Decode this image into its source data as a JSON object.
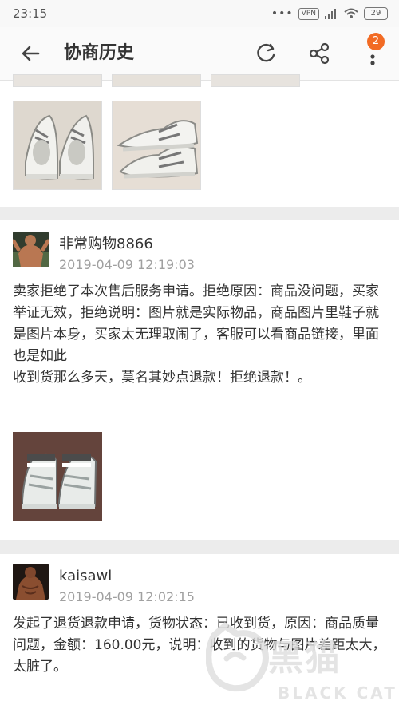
{
  "status_bar": {
    "time": "23:15",
    "indicators": "•••",
    "vpn": "VPN",
    "battery": "29"
  },
  "app_bar": {
    "title": "协商历史",
    "badge_count": "2",
    "icons": [
      "back-arrow",
      "refresh",
      "share",
      "more-vertical"
    ]
  },
  "entries": [
    {
      "username": "非常购物8866",
      "timestamp": "2019-04-09 12:19:03",
      "message": "卖家拒绝了本次售后服务申请。拒绝原因：商品没问题，买家举证无效，拒绝说明：图片就是实际物品，商品图片里鞋子就是图片本身，买家太无理取闹了，客服可以看商品链接，里面也是如此\n收到货那么多天，莫名其妙点退款！拒绝退款！。"
    },
    {
      "username": "kaisawl",
      "timestamp": "2019-04-09 12:02:15",
      "message": "发起了退货退款申请，货物状态：已收到货，原因：商品质量问题，金额：160.00元，说明：收到的货物与图片差距太大，太脏了。"
    }
  ],
  "watermark": {
    "title": "黑猫",
    "subtitle": "BLACK CAT"
  },
  "colors": {
    "accent_badge": "#f26b24",
    "page_background": "#ececec",
    "card_background": "#ffffff",
    "timestamp_text": "#a0a0a0"
  }
}
